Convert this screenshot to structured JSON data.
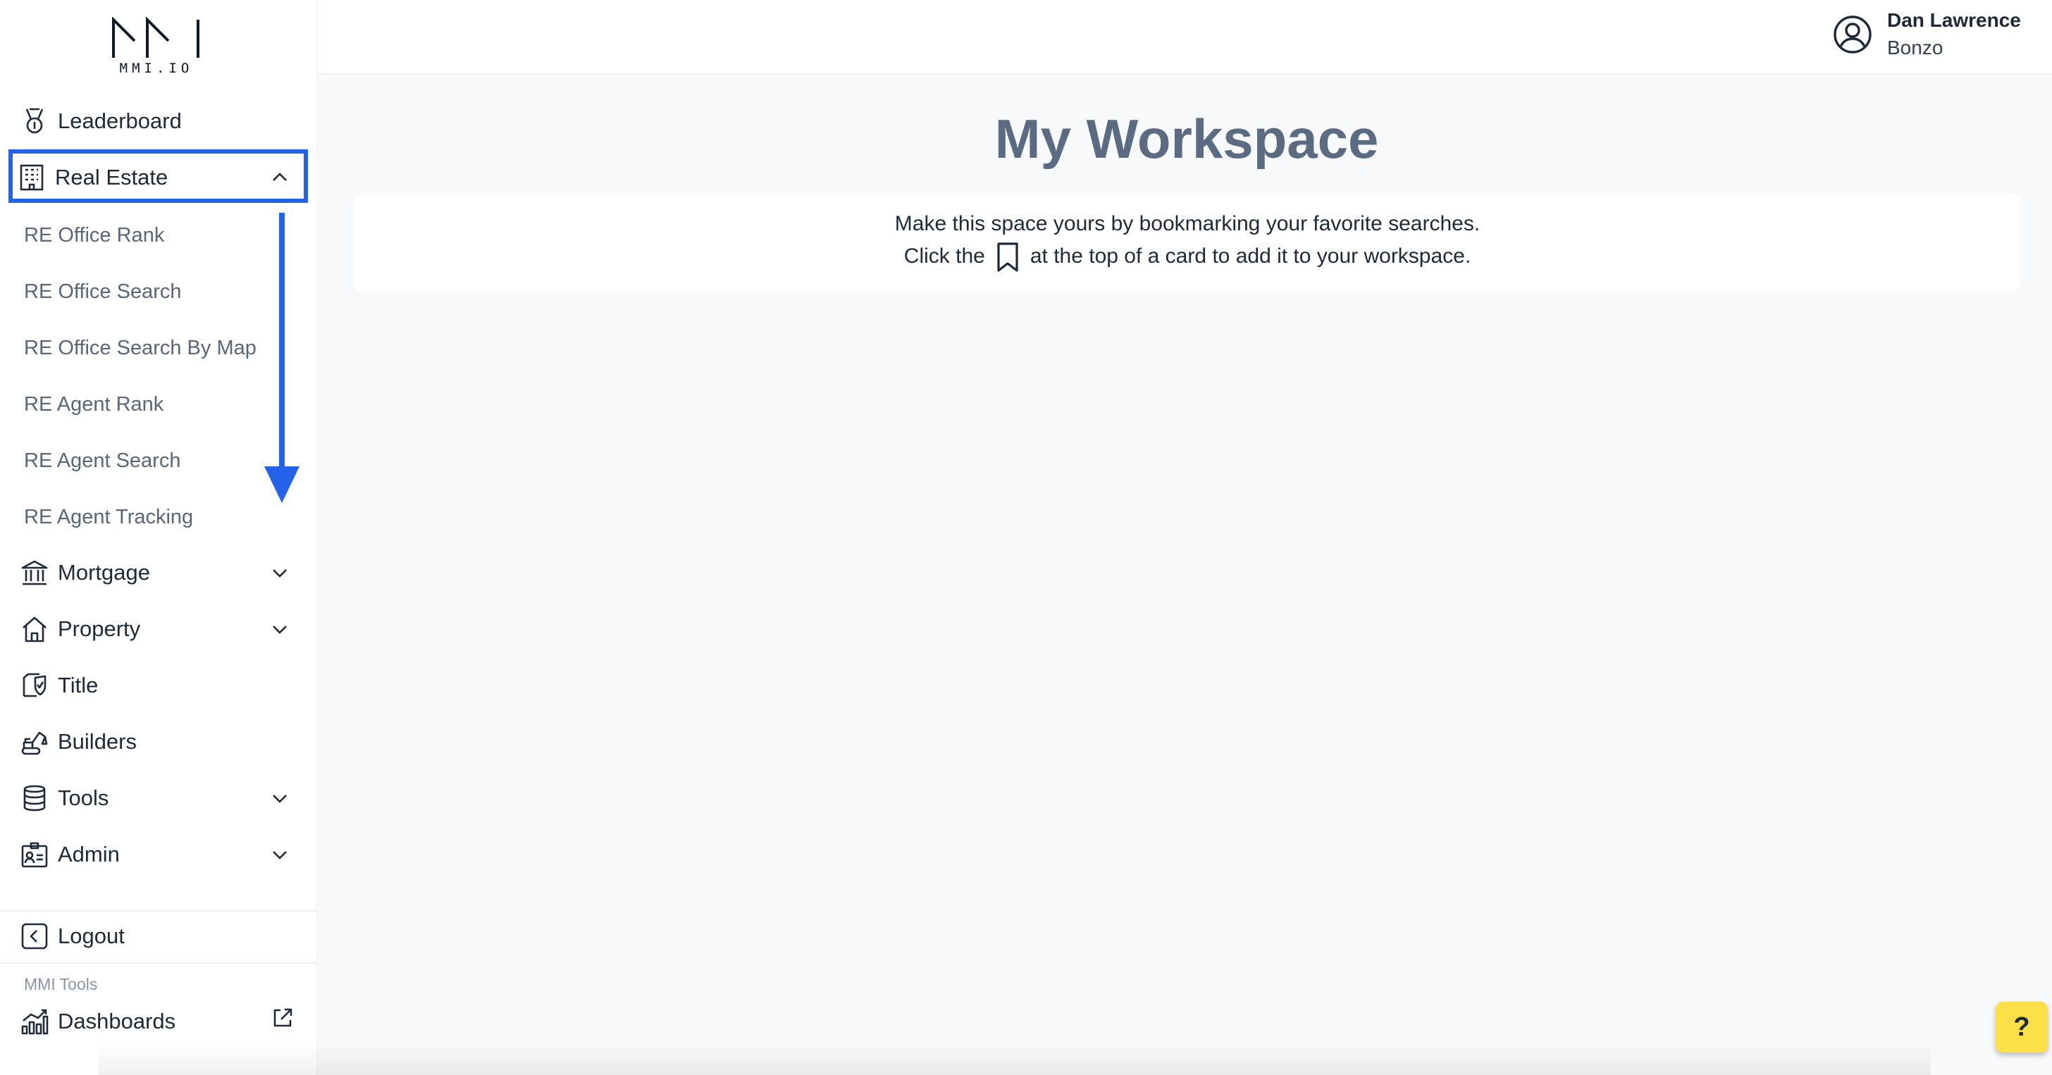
{
  "brand": {
    "logo_text": "MMI.IO"
  },
  "user": {
    "name": "Dan Lawrence",
    "organization": "Bonzo"
  },
  "sidebar": {
    "items": [
      {
        "label": "Leaderboard",
        "icon": "medal-icon"
      },
      {
        "label": "Real Estate",
        "icon": "building-icon",
        "expanded": true,
        "children": [
          {
            "label": "RE Office Rank"
          },
          {
            "label": "RE Office Search"
          },
          {
            "label": "RE Office Search By Map"
          },
          {
            "label": "RE Agent Rank"
          },
          {
            "label": "RE Agent Search"
          },
          {
            "label": "RE Agent Tracking"
          }
        ]
      },
      {
        "label": "Mortgage",
        "icon": "bank-icon",
        "expanded": false
      },
      {
        "label": "Property",
        "icon": "house-icon",
        "expanded": false
      },
      {
        "label": "Title",
        "icon": "title-icon"
      },
      {
        "label": "Builders",
        "icon": "excavator-icon"
      },
      {
        "label": "Tools",
        "icon": "database-icon",
        "expanded": false
      },
      {
        "label": "Admin",
        "icon": "id-card-icon",
        "expanded": false
      }
    ],
    "logout": {
      "label": "Logout",
      "icon": "logout-icon"
    },
    "section_label": "MMI Tools",
    "dashboards": {
      "label": "Dashboards",
      "icon": "bar-chart-icon"
    }
  },
  "main": {
    "title": "My Workspace",
    "info": {
      "line1": "Make this space yours by bookmarking your favorite searches.",
      "line2_before": "Click the",
      "line2_after": "at the top of a card to add it to your workspace."
    }
  },
  "help": {
    "label": "?"
  },
  "annotation": {
    "highlight_color": "#2463e8"
  },
  "colors": {
    "accent": "#2463e8",
    "help_button": "#fde047",
    "title": "#5b6b82"
  }
}
